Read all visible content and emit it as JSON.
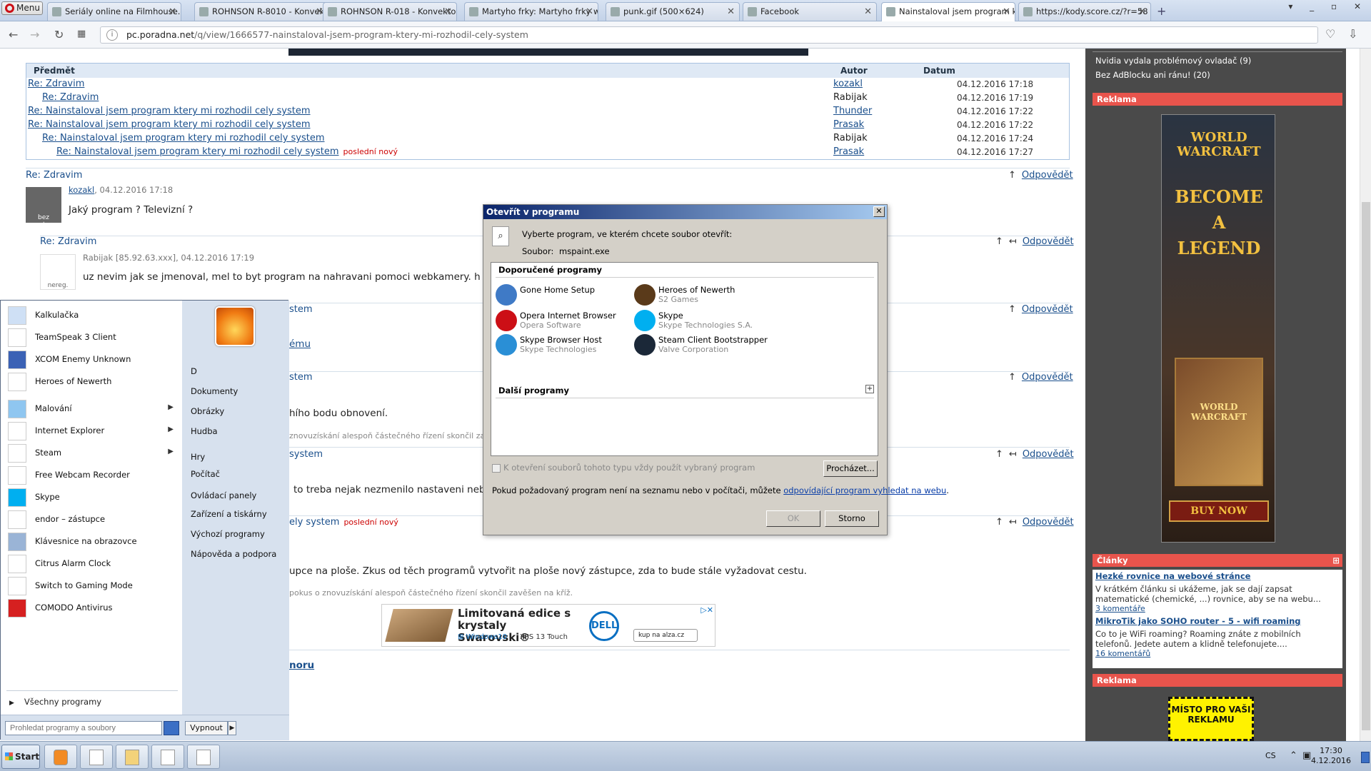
{
  "browser": {
    "menu_label": "Menu",
    "tabs": [
      {
        "label": "Seriály online na Filmhouse.c",
        "active": false
      },
      {
        "label": "ROHNSON R-8010 - Konvekt",
        "active": false
      },
      {
        "label": "ROHNSON R-018 - Konvekto",
        "active": false
      },
      {
        "label": "Martyho frky: Martyho frky w",
        "active": false
      },
      {
        "label": "punk.gif (500×624)",
        "active": false
      },
      {
        "label": "Facebook",
        "active": false
      },
      {
        "label": "Nainstaloval jsem program k",
        "active": true
      },
      {
        "label": "https://kody.score.cz/?r=58",
        "active": false
      }
    ],
    "new_tab": "+",
    "url_domain": "pc.poradna.net",
    "url_path": "/q/view/1666577-nainstaloval-jsem-program-ktery-mi-rozhodil-cely-system"
  },
  "thread": {
    "col_subject": "Předmět",
    "col_author": "Autor",
    "col_date": "Datum",
    "rows": [
      {
        "subject": "Re: Zdravim",
        "author": "kozakl",
        "author_link": true,
        "date": "04.12.2016 17:18",
        "indent": 0,
        "new": ""
      },
      {
        "subject": "Re: Zdravim",
        "author": "Rabijak",
        "author_link": false,
        "date": "04.12.2016 17:19",
        "indent": 1,
        "new": ""
      },
      {
        "subject": "Re: Nainstaloval jsem program ktery mi rozhodil cely system",
        "author": "Thunder",
        "author_link": true,
        "date": "04.12.2016 17:22",
        "indent": 0,
        "new": ""
      },
      {
        "subject": "Re: Nainstaloval jsem program ktery mi rozhodil cely system",
        "author": "Prasak",
        "author_link": true,
        "date": "04.12.2016 17:22",
        "indent": 0,
        "new": ""
      },
      {
        "subject": "Re: Nainstaloval jsem program ktery mi rozhodil cely system",
        "author": "Rabijak",
        "author_link": false,
        "date": "04.12.2016 17:24",
        "indent": 1,
        "new": ""
      },
      {
        "subject": "Re: Nainstaloval jsem program ktery mi rozhodil cely system",
        "author": "Prasak",
        "author_link": true,
        "date": "04.12.2016 17:27",
        "indent": 2,
        "new": "poslední nový"
      }
    ]
  },
  "posts": {
    "reply_label": "Odpovědět",
    "p1_title": "Re: Zdravim",
    "p1_author": "kozakl",
    "p1_date": ", 04.12.2016 17:18",
    "p1_avatar": "bez avataru",
    "p1_text": "Jaký program ? Televizní ?",
    "p2_title": "Re: Zdravim",
    "p2_meta": "Rabijak [85.92.63.xxx], 04.12.2016 17:19",
    "p2_avatar": "nereg.",
    "p2_text": "uz nevim jak se jmenoval, mel to byt program na nahravani pomoci webkamery. h",
    "p3_title_frag": "stem",
    "p3_link_frag": "ému",
    "p4_title_frag": "stem",
    "p4_text_frag": "hího bodu obnovení.",
    "p4_gray_frag": "znovuzískání alespoň částečného řízení skončil za",
    "p5_title_frag": "system",
    "p5_text_frag": "to treba nejak nezmenilo nastaveni neb",
    "p6_title_frag": "ely system",
    "p6_new": "poslední nový",
    "p6_text_frag": "upce na ploše. Zkus od těch programů vytvořit na ploše nový zástupce, zda to bude stále vyžadovat cestu.",
    "p6_gray_frag": "pokus o znovuzískání alespoň částečného řízení skončil zavěšen na kříž.",
    "bottom_link_frag": "noru"
  },
  "ad": {
    "headline": "Limitovaná edice s krystaly Swarovski®",
    "os": "Windows10",
    "model": "XPS 13 Touch",
    "brand": "DELL",
    "shop": "kup na  alza.cz"
  },
  "sidebar": {
    "links": [
      "Nvidia vydala problémový ovladač (9)",
      "Bez AdBlocku ani ránu! (20)"
    ],
    "ad_header": "Reklama",
    "wow": {
      "logo": "WORLD WARCRAFT",
      "line1": "BECOME",
      "line2": "A",
      "line3": "LEGEND",
      "box": "WORLD WARCRAFT",
      "buy": "BUY NOW"
    },
    "articles_header": "Články",
    "articles": [
      {
        "title": "Hezké rovnice na webové stránce",
        "text": "V krátkém článku si ukážeme, jak se dají zapsat matematické (chemické, ...) rovnice, aby se na webu...",
        "comments": "3 komentáře"
      },
      {
        "title": "MikroTik jako SOHO router - 5 - wifi roaming",
        "text": "Co to je WiFi roaming? Roaming znáte z mobilních telefonů. Jedete autem a klidně telefonujete....",
        "comments": "16 komentářů"
      }
    ],
    "ad2_header": "Reklama",
    "ad2_text": "MÍSTO PRO VAŠI REKLAMU"
  },
  "dialog": {
    "title": "Otevřít v programu",
    "instruction": "Vyberte program, ve kterém chcete soubor otevřít:",
    "file_label": "Soubor:",
    "file_name": "mspaint.exe",
    "recommended": "Doporučené programy",
    "other": "Další programy",
    "programs": [
      {
        "name": "Gone Home Setup",
        "company": "",
        "color": "#3f7ac6"
      },
      {
        "name": "Heroes of Newerth",
        "company": "S2 Games",
        "color": "#5a3a1a"
      },
      {
        "name": "Opera Internet Browser",
        "company": "Opera Software",
        "color": "#cc0f16"
      },
      {
        "name": "Skype",
        "company": "Skype Technologies S.A.",
        "color": "#00aff0"
      },
      {
        "name": "Skype Browser Host",
        "company": "Skype Technologies",
        "color": "#2a8fd6"
      },
      {
        "name": "Steam Client Bootstrapper",
        "company": "Valve Corporation",
        "color": "#1b2838"
      }
    ],
    "always_use": "K otevření souborů tohoto typu vždy použít vybraný program",
    "browse": "Procházet...",
    "hint": "Pokud požadovaný program není na seznamu nebo v počítači, můžete",
    "hint_link": "odpovídající program vyhledat na webu",
    "ok": "OK",
    "cancel": "Storno"
  },
  "startmenu": {
    "left_items": [
      {
        "label": "Kalkulačka",
        "arrow": false
      },
      {
        "label": "TeamSpeak 3 Client",
        "arrow": false
      },
      {
        "label": "XCOM Enemy Unknown",
        "arrow": false
      },
      {
        "label": "Heroes of Newerth",
        "arrow": false
      },
      {
        "label": "Malování",
        "arrow": true
      },
      {
        "label": "Internet Explorer",
        "arrow": true
      },
      {
        "label": "Steam",
        "arrow": true
      },
      {
        "label": "Free Webcam Recorder",
        "arrow": false
      },
      {
        "label": "Skype",
        "arrow": false
      },
      {
        "label": "endor – zástupce",
        "arrow": false
      },
      {
        "label": "Klávesnice na obrazovce",
        "arrow": false
      },
      {
        "label": "Citrus Alarm Clock",
        "arrow": false
      },
      {
        "label": "Switch to Gaming Mode",
        "arrow": false
      },
      {
        "label": "COMODO Antivirus",
        "arrow": false
      }
    ],
    "all_programs": "Všechny programy",
    "right_items": [
      "D",
      "Dokumenty",
      "Obrázky",
      "Hudba",
      "Hry",
      "Počítač",
      "Ovládací panely",
      "Zařízení a tiskárny",
      "Výchozí programy",
      "Nápověda a podpora"
    ],
    "search_placeholder": "Prohledat programy a soubory",
    "shutdown": "Vypnout"
  },
  "taskbar": {
    "start": "Start",
    "lang": "CS",
    "time": "17:30",
    "date": "4.12.2016"
  }
}
